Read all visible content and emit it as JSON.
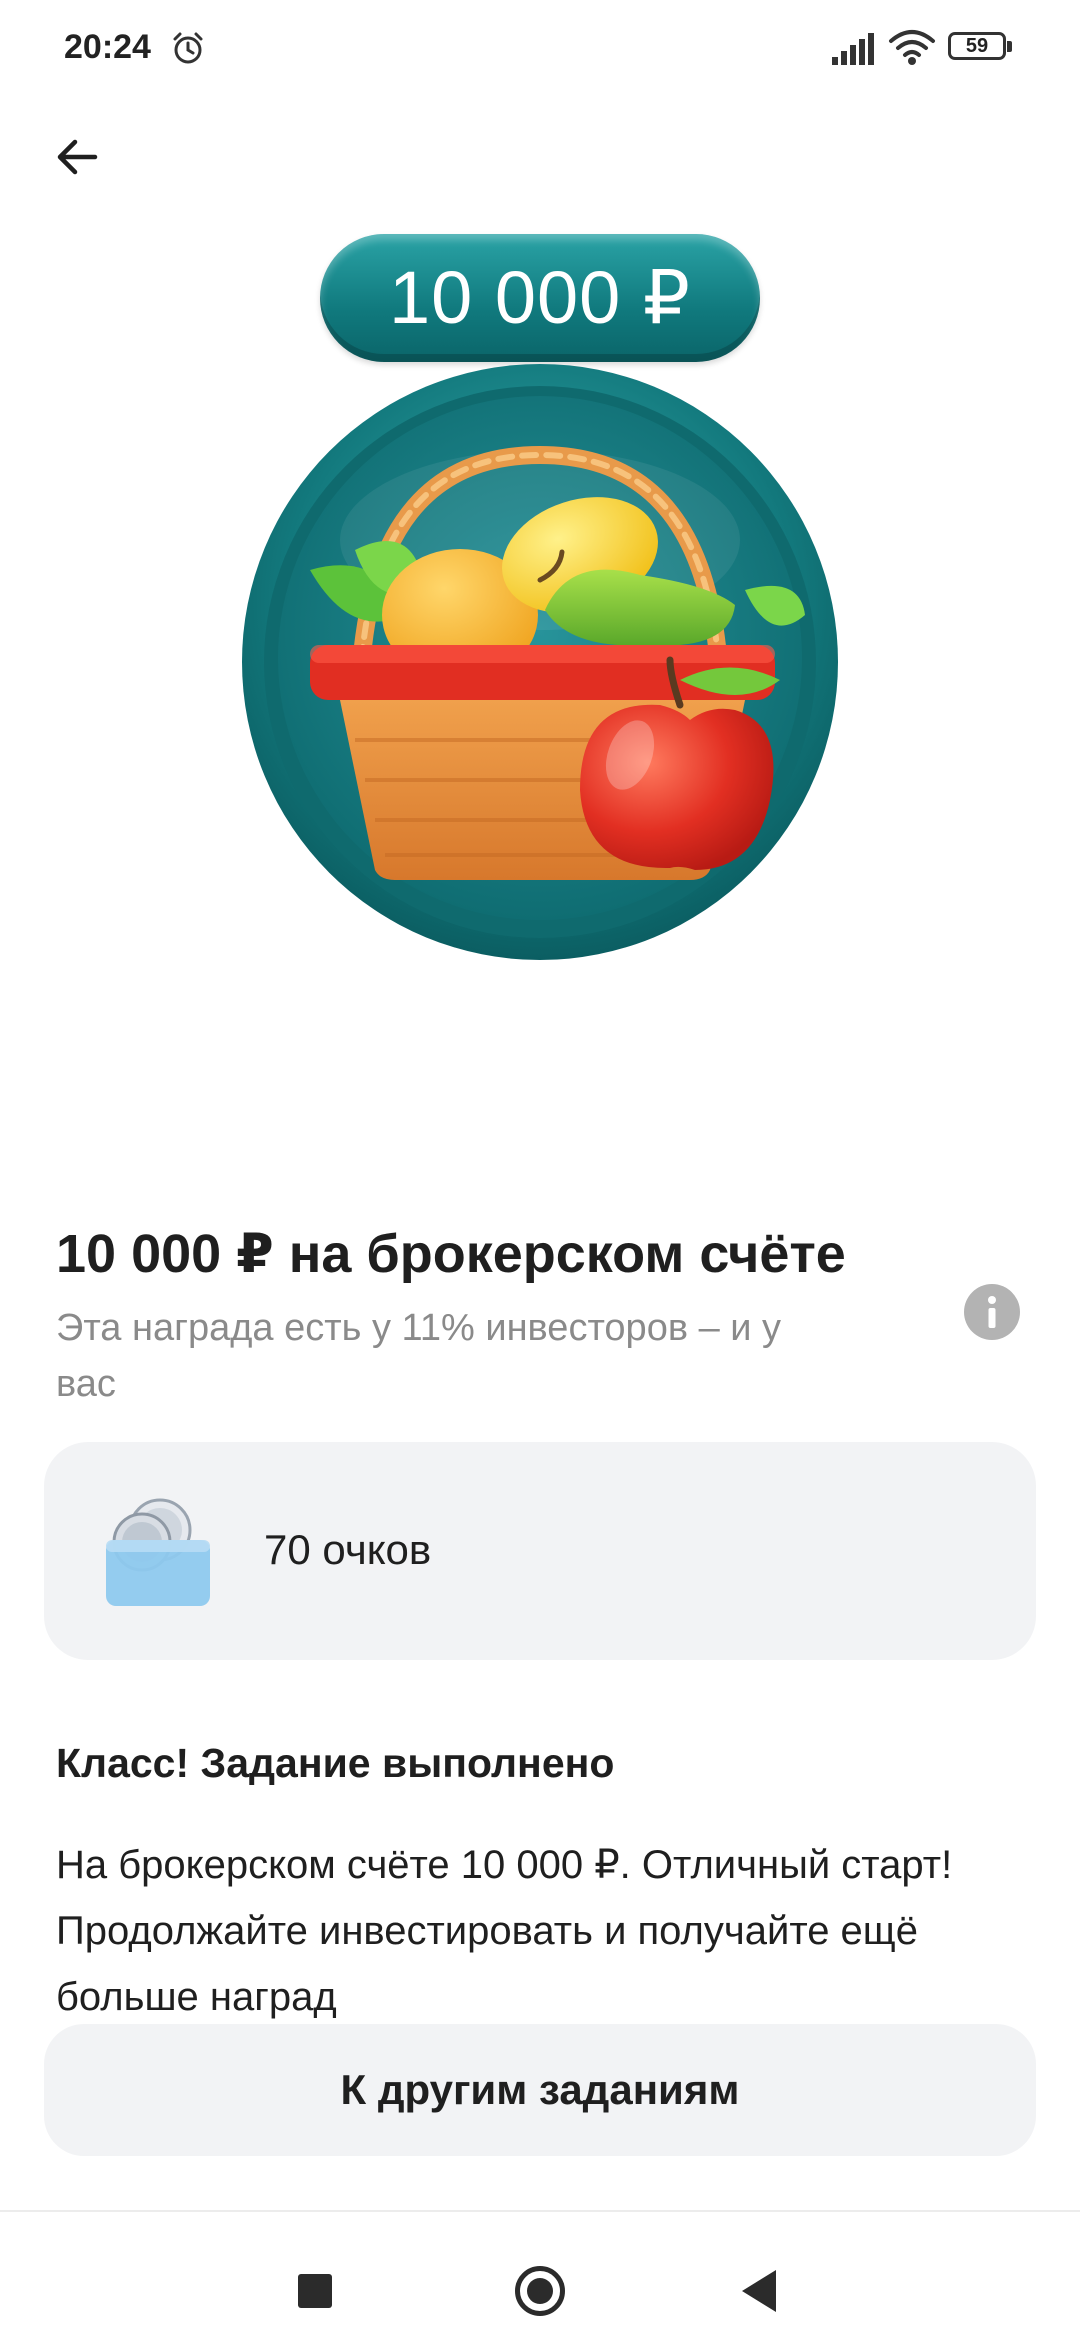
{
  "status_bar": {
    "time": "20:24",
    "icons": [
      "alarm-icon",
      "signal-icon",
      "wifi-icon",
      "battery-icon"
    ],
    "battery_level": "59"
  },
  "header": {
    "back_icon": "arrow-left-icon"
  },
  "reward": {
    "amount_badge": "10 000 ₽",
    "illustration": "fruit-basket-medal",
    "colors": {
      "badge": "#10797d",
      "medal": "#16787c"
    }
  },
  "details": {
    "title": "10 000 ₽ на брокерском счёте",
    "subtitle": "Эта награда есть у 11% инвесторов – и у вас",
    "info_icon": "info-icon"
  },
  "points_card": {
    "icon": "coin-wallet-icon",
    "label": "70 очков"
  },
  "completion": {
    "heading": "Класс! Задание выполнено",
    "body": "На брокерском счёте 10 000 ₽. Отличный старт! Продолжайте инвестировать и получайте ещё больше наград"
  },
  "actions": {
    "other_tasks_label": "К другим заданиям"
  },
  "nav_bar": {
    "buttons": [
      "recents-button",
      "home-button",
      "back-button"
    ]
  }
}
